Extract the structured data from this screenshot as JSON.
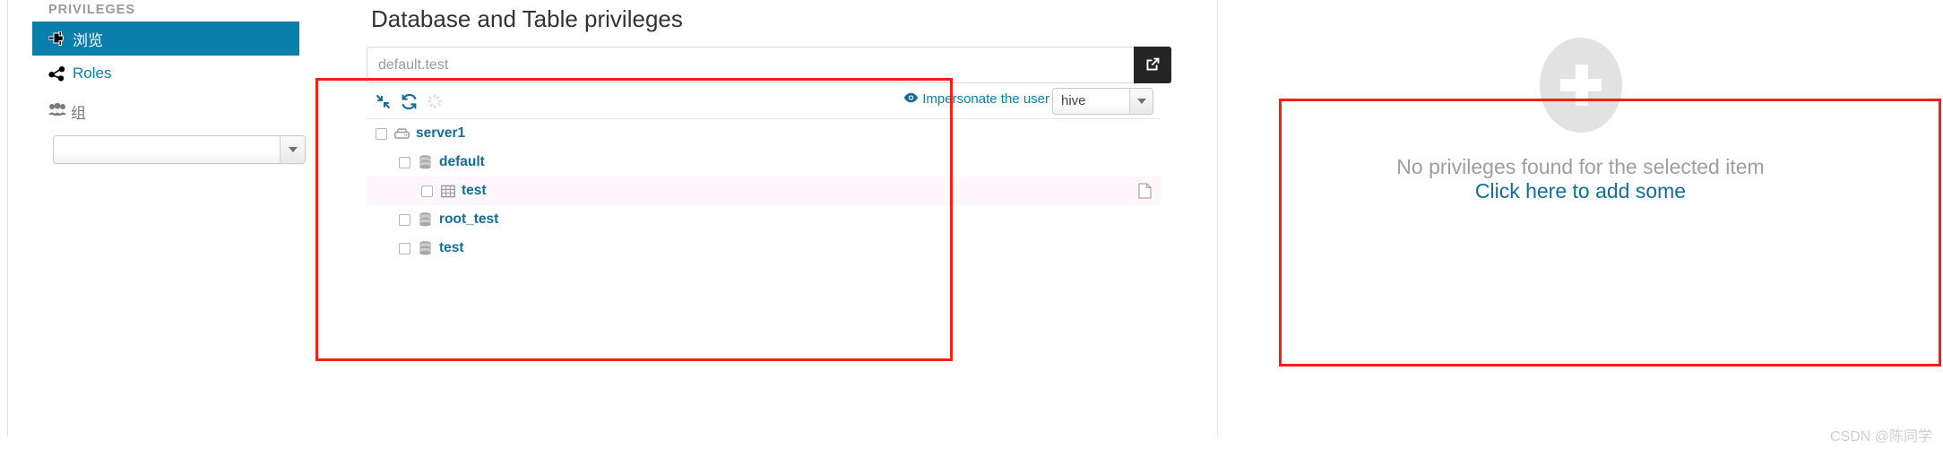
{
  "sidebar": {
    "heading": "PRIVILEGES",
    "items": [
      {
        "id": "browse",
        "label": "浏览",
        "icon": "plug-icon",
        "active": true
      },
      {
        "id": "roles",
        "label": "Roles",
        "icon": "roles-share-icon",
        "active": false
      }
    ],
    "group": {
      "label": "组",
      "icon": "group-users-icon",
      "select_value": "",
      "select_placeholder": ""
    }
  },
  "main": {
    "title": "Database and Table privileges",
    "path": {
      "value": "",
      "placeholder": "default.test",
      "open_button_icon": "external-link-icon"
    },
    "toolbar": {
      "collapse_icon": "collapse-arrows-icon",
      "refresh_icon": "refresh-icon",
      "spinner_icon": "loading-spinner-icon",
      "impersonate_label": "Impersonate the user",
      "impersonate_icon": "eye-icon",
      "user_select_value": "hive"
    },
    "tree": [
      {
        "level": 1,
        "label": "server1",
        "icon": "server-icon",
        "checked": false,
        "selected": false,
        "doc_icon": null
      },
      {
        "level": 2,
        "label": "default",
        "icon": "database-icon",
        "checked": false,
        "selected": false,
        "doc_icon": null
      },
      {
        "level": 3,
        "label": "test",
        "icon": "table-icon",
        "checked": false,
        "selected": true,
        "doc_icon": "document-icon"
      },
      {
        "level": 2,
        "label": "root_test",
        "icon": "database-icon",
        "checked": false,
        "selected": false,
        "doc_icon": null
      },
      {
        "level": 2,
        "label": "test",
        "icon": "database-icon",
        "checked": false,
        "selected": false,
        "doc_icon": null
      }
    ]
  },
  "right_panel": {
    "plus_icon": "plus-circle-icon",
    "empty_message": "No privileges found for the selected item",
    "add_link": "Click here to add some"
  },
  "watermark": "CSDN @陈同学",
  "colors": {
    "accent": "#0b7fab",
    "link": "#136d97",
    "annotation_red": "#fa1e0e",
    "selected_row": "#fdf7fb",
    "dark_button": "#252525"
  }
}
